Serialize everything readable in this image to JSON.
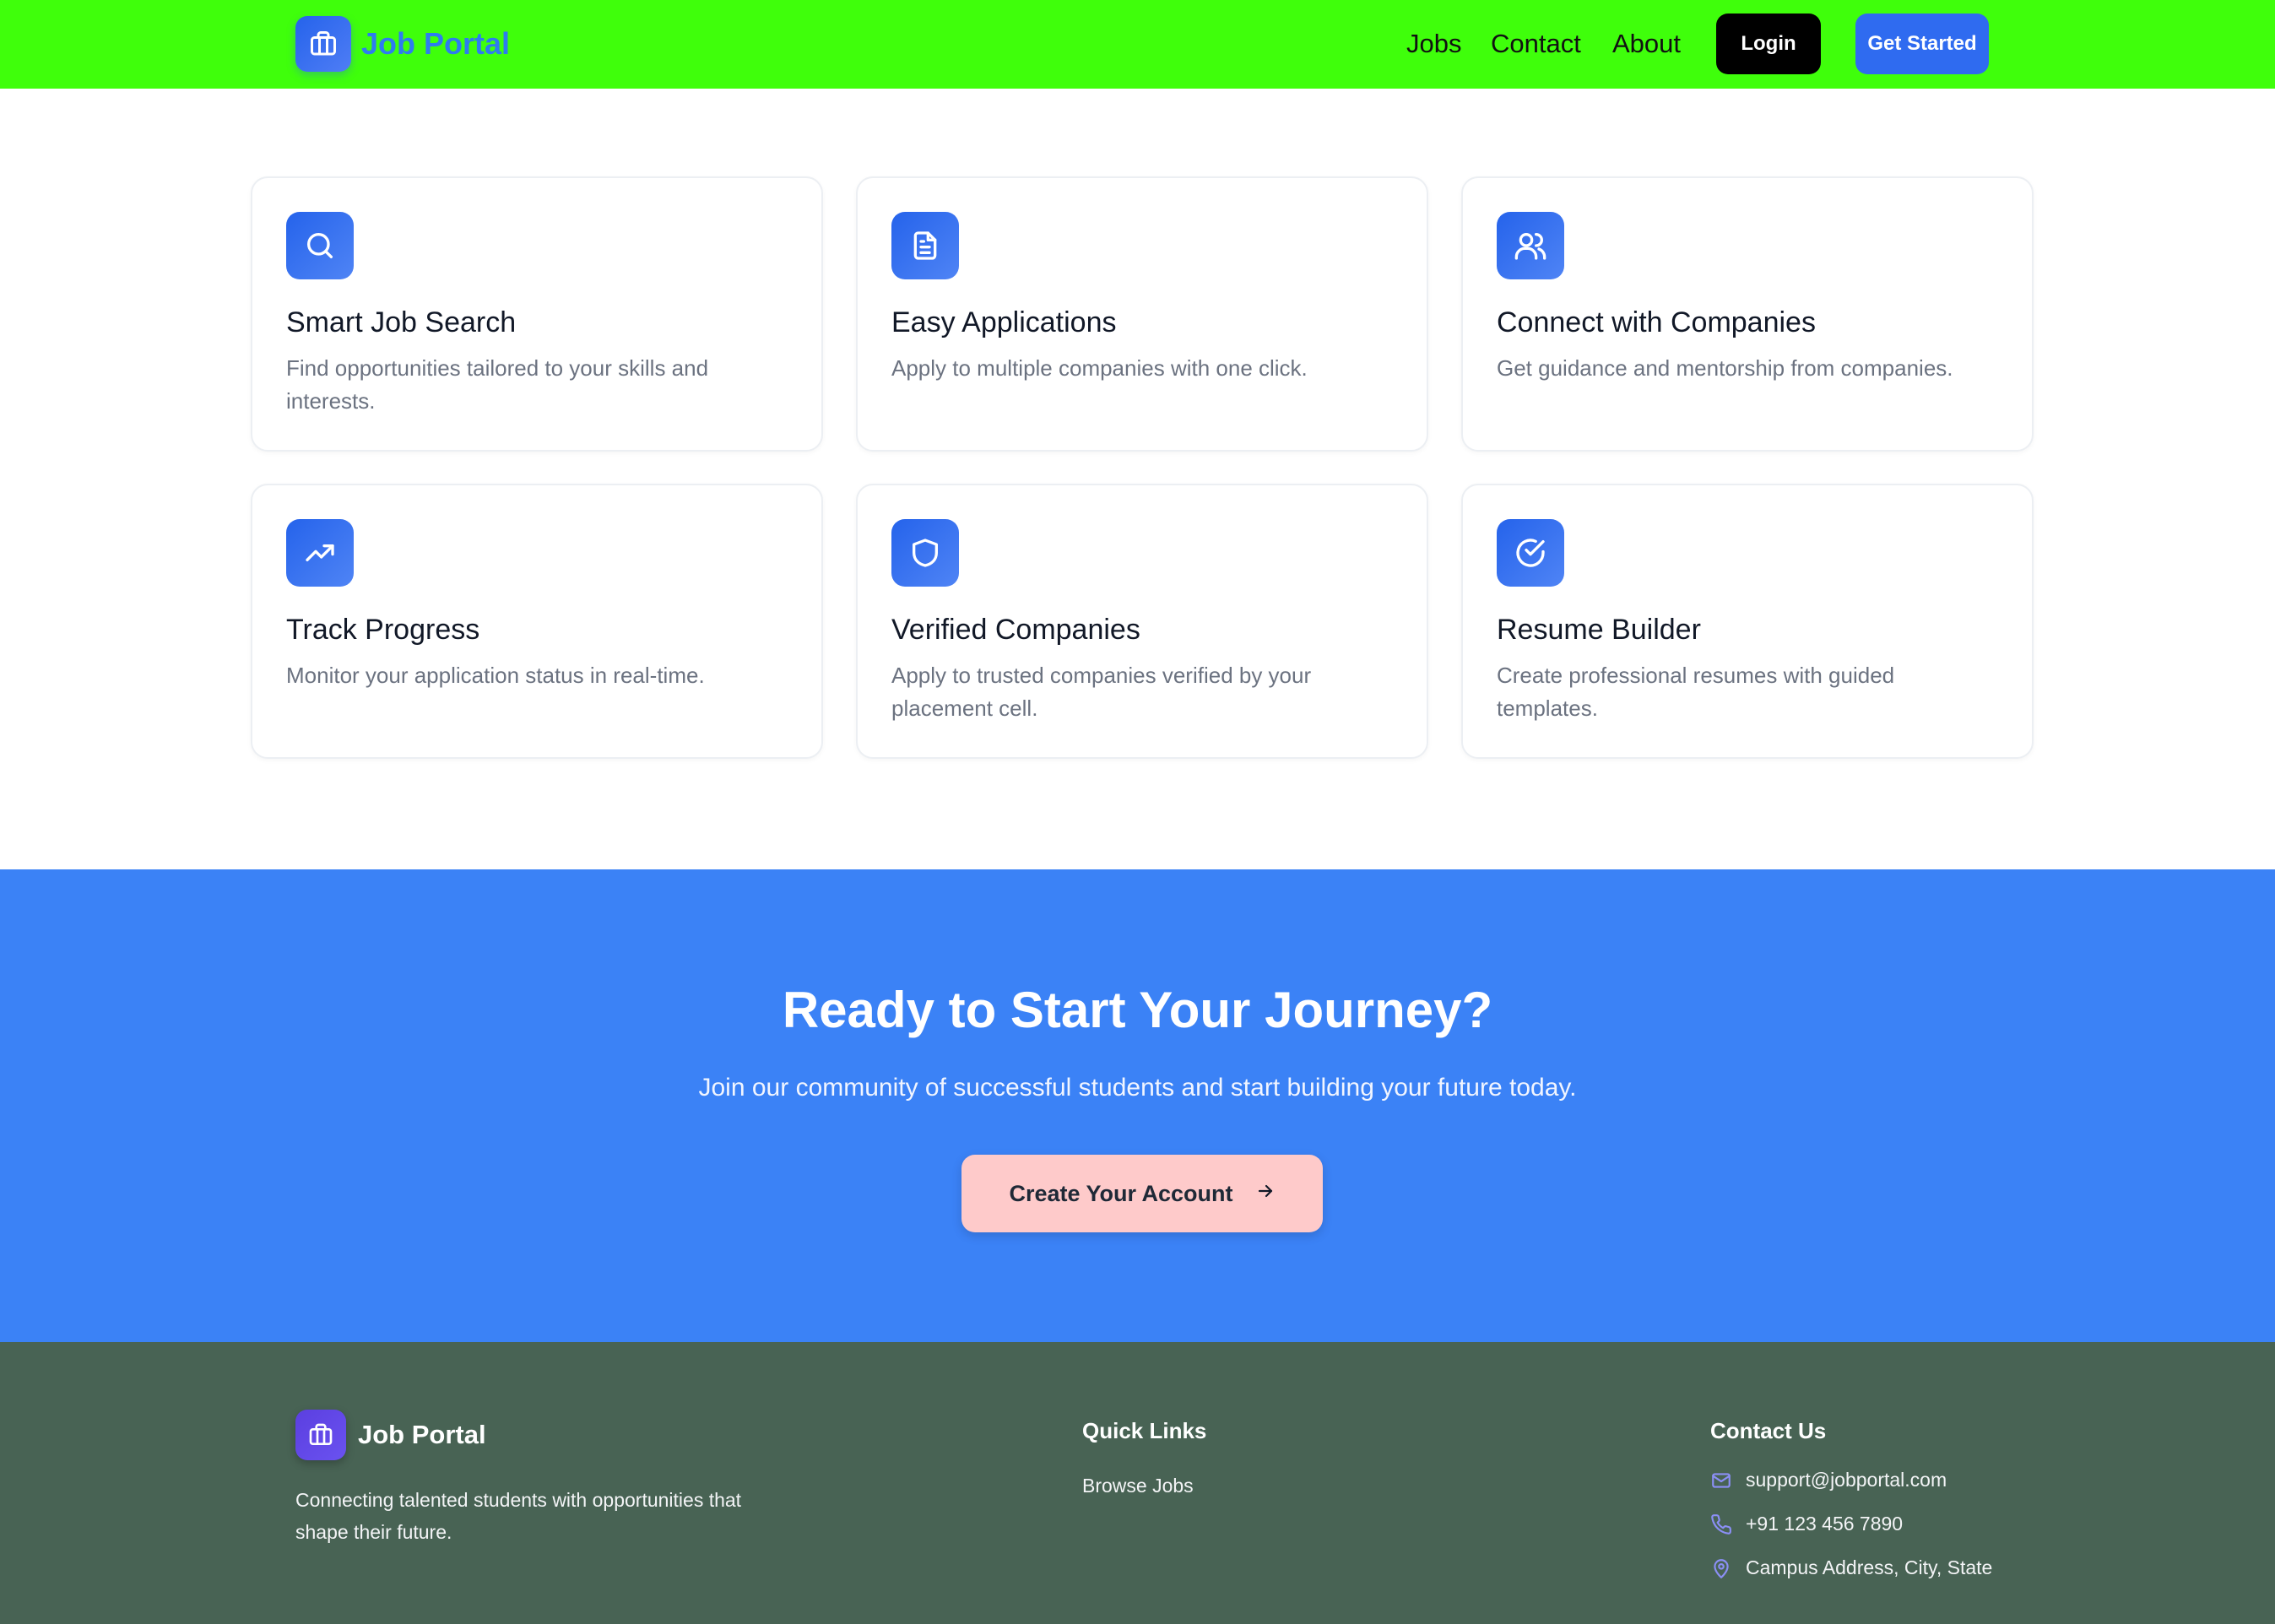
{
  "header": {
    "brand": "Job Portal",
    "nav": [
      "Jobs",
      "Contact",
      "About"
    ],
    "login_label": "Login",
    "get_started_label": "Get Started"
  },
  "features": [
    {
      "title": "Smart Job Search",
      "desc": "Find opportunities tailored to your skills and interests.",
      "icon": "search-icon"
    },
    {
      "title": "Easy Applications",
      "desc": "Apply to multiple companies with one click.",
      "icon": "document-icon"
    },
    {
      "title": "Connect with Companies",
      "desc": "Get guidance and mentorship from companies.",
      "icon": "users-icon"
    },
    {
      "title": "Track Progress",
      "desc": "Monitor your application status in real-time.",
      "icon": "trending-up-icon"
    },
    {
      "title": "Verified Companies",
      "desc": "Apply to trusted companies verified by your placement cell.",
      "icon": "shield-icon"
    },
    {
      "title": "Resume Builder",
      "desc": "Create professional resumes with guided templates.",
      "icon": "check-circle-icon"
    }
  ],
  "cta": {
    "title": "Ready to Start Your Journey?",
    "subtitle": "Join our community of successful students and start building your future today.",
    "button_label": "Create Your Account"
  },
  "footer": {
    "brand": "Job Portal",
    "description": "Connecting talented students with opportunities that shape their future.",
    "quick_links_heading": "Quick Links",
    "quick_links": [
      "Browse Jobs"
    ],
    "contact_heading": "Contact Us",
    "email": "support@jobportal.com",
    "phone": "+91 123 456 7890",
    "address": "Campus Address, City, State"
  },
  "colors": {
    "header_bg": "#3fff0b",
    "primary": "#3b82f6",
    "cta_button": "#fecaca",
    "footer_bg": "#486354"
  }
}
